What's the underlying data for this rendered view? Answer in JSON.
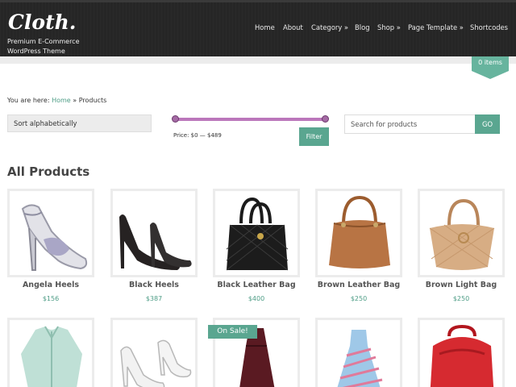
{
  "header": {
    "logo": "Cloth.",
    "tagline": "Premium E-Commerce WordPress Theme",
    "nav": [
      "Home",
      "About",
      "Category »",
      "Blog",
      "Shop »",
      "Page Template »",
      "Shortcodes"
    ]
  },
  "cart": {
    "label": "0 items"
  },
  "breadcrumb": {
    "prefix": "You are here:",
    "home": "Home",
    "separator": "»",
    "current": "Products"
  },
  "toolbar": {
    "sort_label": "Sort alphabetically",
    "price_label": "Price: $0 — $489",
    "filter_label": "Filter",
    "search_placeholder": "Search for products",
    "go_label": "GO",
    "price_range_fraction": [
      0,
      1
    ]
  },
  "section_title": "All Products",
  "products": [
    {
      "name": "Angela Heels",
      "price": "$156",
      "icon": "heel-sandal-icon"
    },
    {
      "name": "Black Heels",
      "price": "$387",
      "icon": "black-heels-icon"
    },
    {
      "name": "Black Leather Bag",
      "price": "$400",
      "icon": "black-bag-icon"
    },
    {
      "name": "Brown Leather Bag",
      "price": "$250",
      "icon": "brown-bag-icon"
    },
    {
      "name": "Brown Light Bag",
      "price": "$250",
      "icon": "light-bag-icon"
    },
    {
      "name": "",
      "price": "",
      "icon": "shirt-icon"
    },
    {
      "name": "",
      "price": "",
      "icon": "white-heels-icon"
    },
    {
      "name": "",
      "price": "",
      "icon": "red-dress-icon"
    },
    {
      "name": "",
      "price": "",
      "icon": "striped-dress-icon"
    },
    {
      "name": "",
      "price": "",
      "icon": "red-backpack-icon"
    }
  ],
  "sale_badge": "On Sale!",
  "colors": {
    "accent": "#5aa690",
    "header_bg": "#262626",
    "slider": "#bb77bb"
  }
}
